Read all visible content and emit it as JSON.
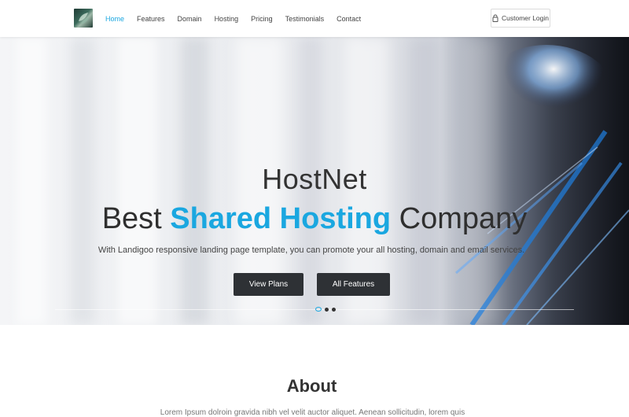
{
  "header": {
    "nav": [
      "Home",
      "Features",
      "Domain",
      "Hosting",
      "Pricing",
      "Testimonials",
      "Contact"
    ],
    "active_nav": "Home",
    "login_label": "Customer Login",
    "login_icon": "lock-icon"
  },
  "hero": {
    "title": "HostNet",
    "heading_pre": "Best",
    "heading_accent": "Shared Hosting",
    "heading_post": "Company",
    "subtitle": "With Landigoo responsive landing page template, you can promote your all hosting, domain and email services.",
    "buttons": [
      "View Plans",
      "All Features"
    ],
    "slider": {
      "slides": 3,
      "active": 1
    }
  },
  "about": {
    "title": "About",
    "text": "Lorem Ipsum dolroin gravida nibh vel velit auctor aliquet. Aenean sollicitudin, lorem quis"
  },
  "colors": {
    "accent": "#1aa7e0",
    "button_dark": "#2e3135",
    "text": "#333333"
  }
}
